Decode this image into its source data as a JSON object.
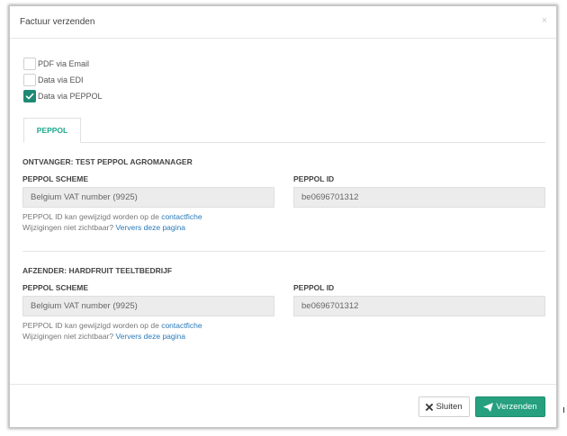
{
  "modal": {
    "title": "Factuur verzenden",
    "close_glyph": "×"
  },
  "options": [
    {
      "label": "PDF via Email",
      "checked": false
    },
    {
      "label": "Data via EDI",
      "checked": false
    },
    {
      "label": "Data via PEPPOL",
      "checked": true
    }
  ],
  "tabs": [
    {
      "label": "PEPPOL",
      "active": true
    }
  ],
  "receiver": {
    "heading": "ONTVANGER: TEST PEPPOL AGROMANAGER",
    "scheme_label": "PEPPOL SCHEME",
    "scheme_value": "Belgium VAT number (9925)",
    "id_label": "PEPPOL ID",
    "id_value": "be0696701312",
    "help_text_1": "PEPPOL ID kan gewijzigd worden op de ",
    "help_link_1": "contactfiche",
    "help_text_2": "Wijzigingen niet zichtbaar? ",
    "help_link_2": "Ververs deze pagina"
  },
  "sender": {
    "heading": "AFZENDER: HARDFRUIT TEELTBEDRIJF",
    "scheme_label": "PEPPOL SCHEME",
    "scheme_value": "Belgium VAT number (9925)",
    "id_label": "PEPPOL ID",
    "id_value": "be0696701312",
    "help_text_1": "PEPPOL ID kan gewijzigd worden op de ",
    "help_link_1": "contactfiche",
    "help_text_2": "Wijzigingen niet zichtbaar? ",
    "help_link_2": "Ververs deze pagina"
  },
  "footer": {
    "close_label": "Sluiten",
    "close_icon": "times-icon",
    "send_label": "Verzenden",
    "send_icon": "paper-plane-icon"
  },
  "colors": {
    "accent": "#26a07f",
    "tab_text": "#1fa88c",
    "link": "#2a7ab8",
    "checkbox_checked": "#1e8a75"
  }
}
